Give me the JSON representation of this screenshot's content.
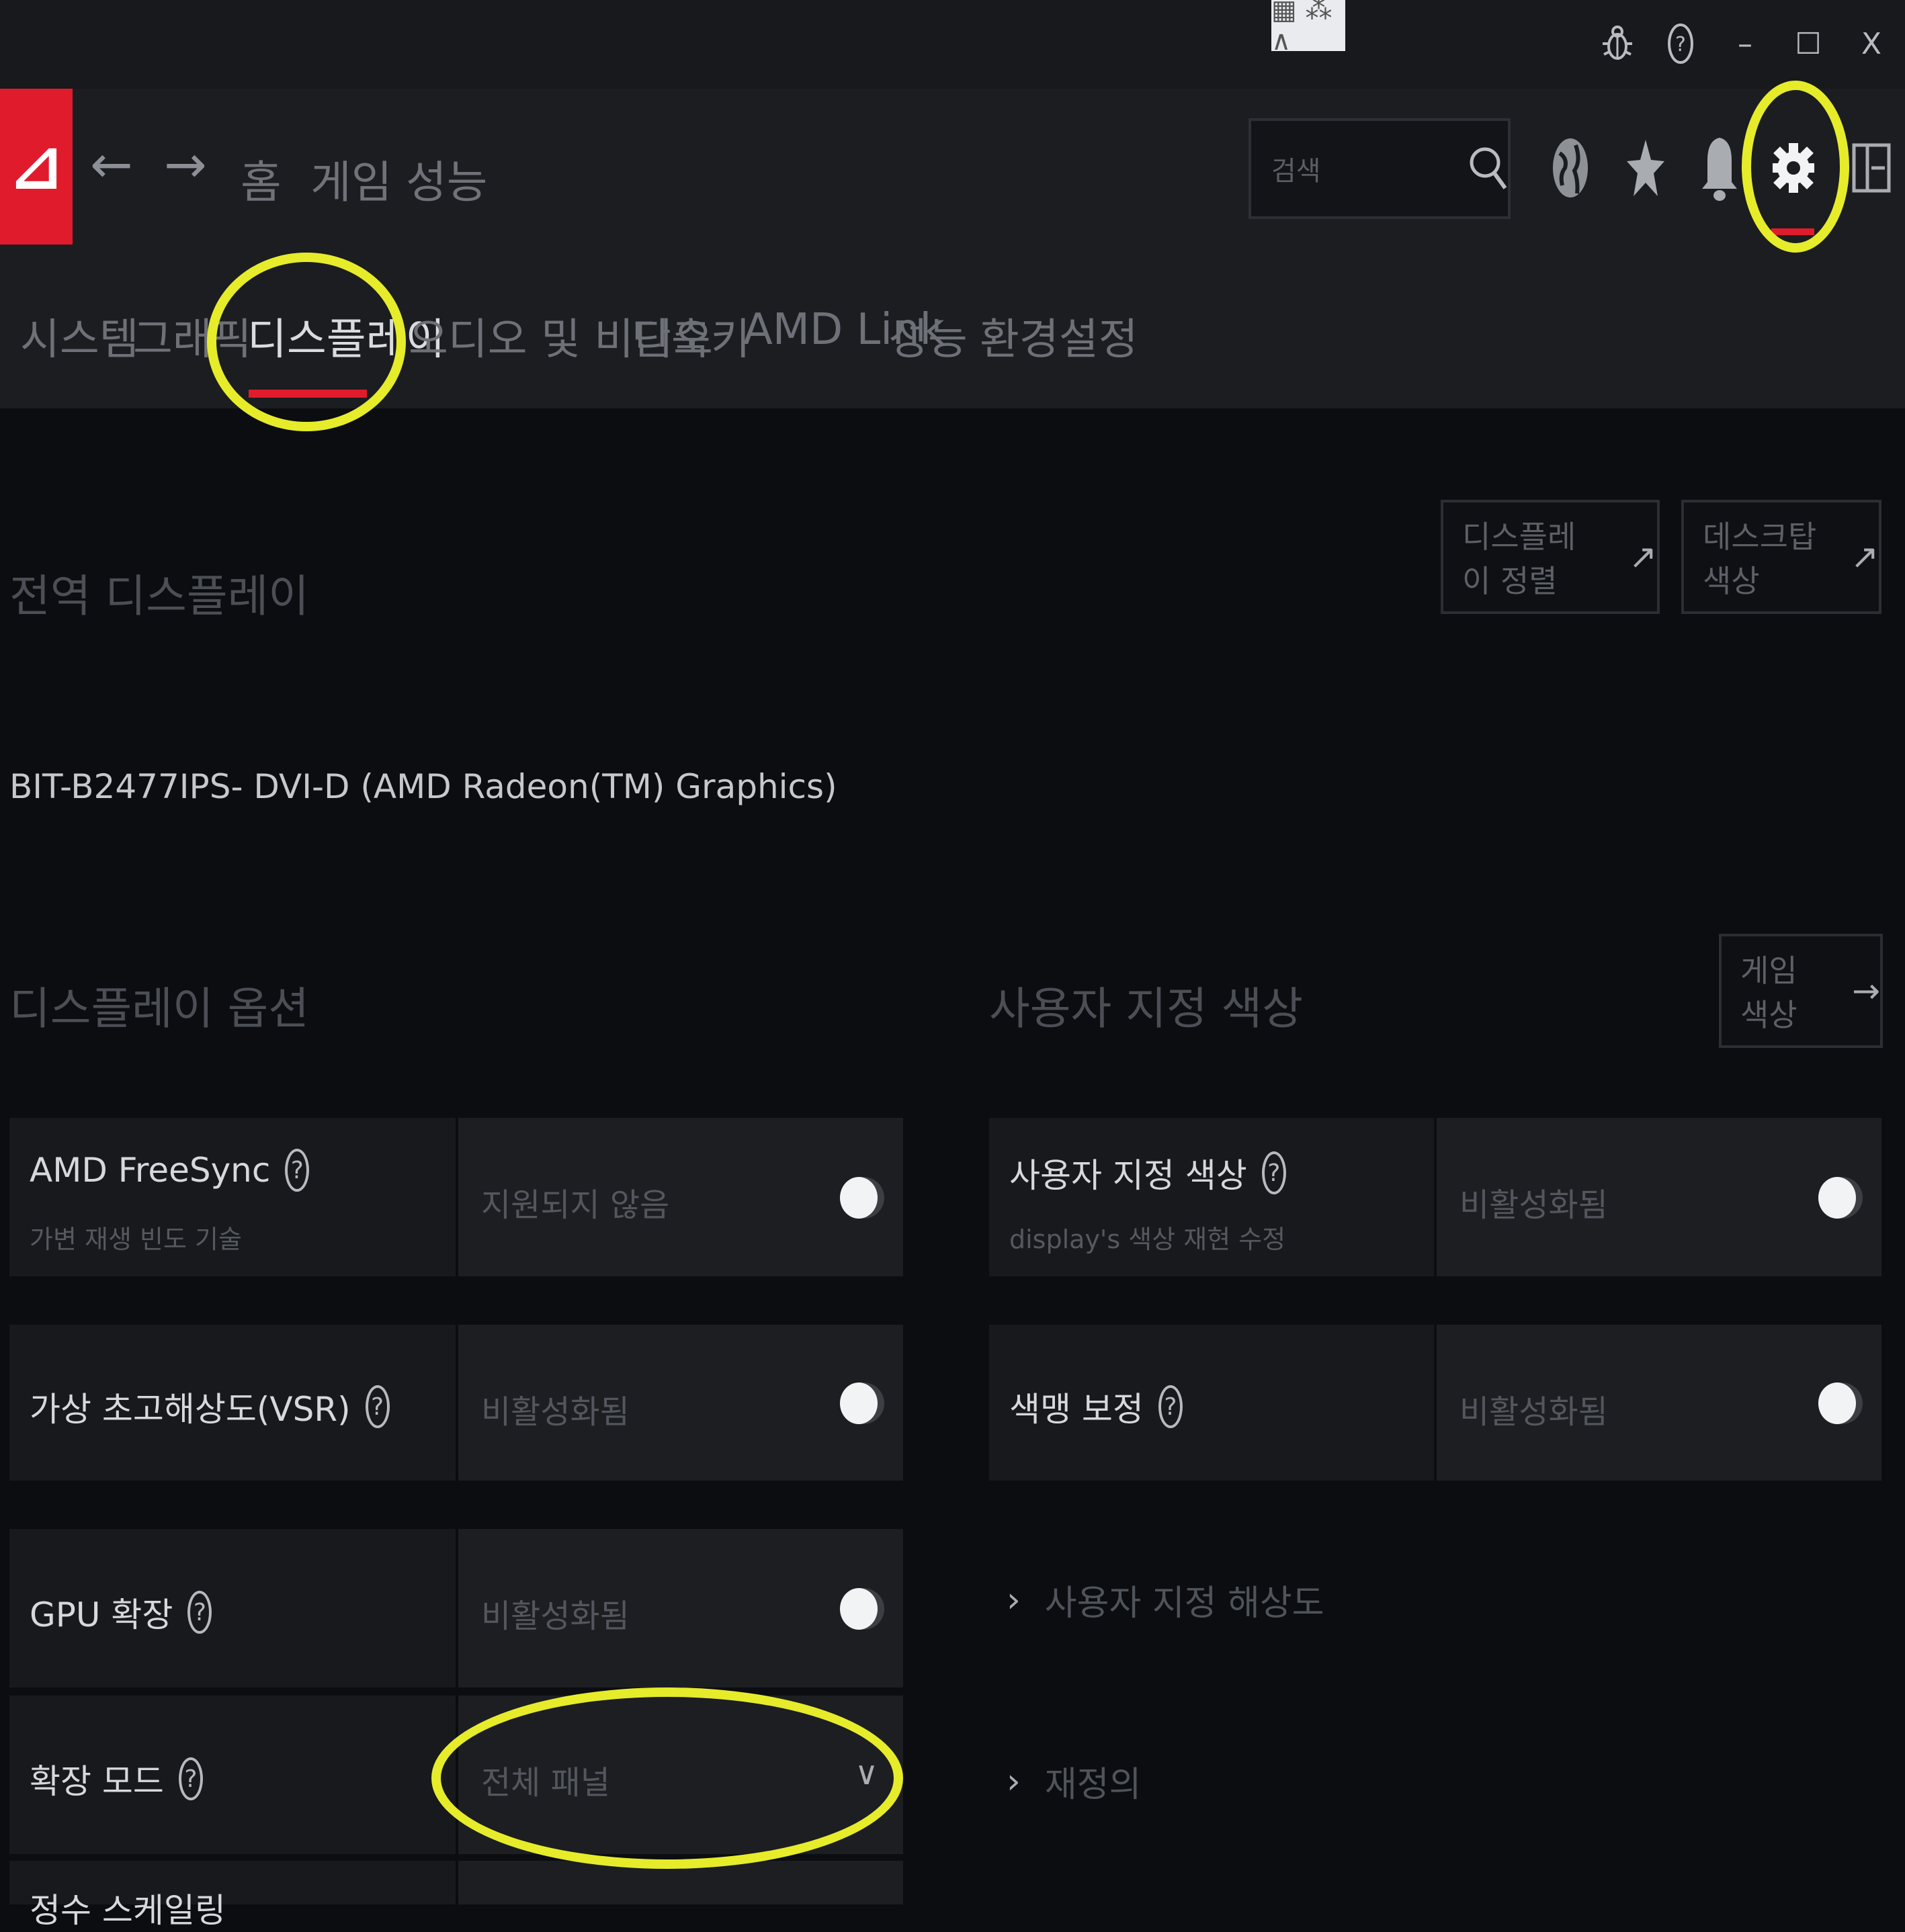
{
  "titlebar": {
    "tray_label": "▦ ⁂ ∧",
    "bug_icon": "bug-icon",
    "help_icon": "question-icon",
    "minimize_label": "–",
    "maximize_label": "☐",
    "close_label": "X"
  },
  "nav": {
    "logo_label": "⊿",
    "back_label": "←",
    "forward_label": "→",
    "links": [
      "홈",
      "게임",
      "성능"
    ],
    "search_placeholder": "검색"
  },
  "tabs": [
    {
      "label": "시스템"
    },
    {
      "label": "그래픽"
    },
    {
      "label": "디스플레이",
      "active": true
    },
    {
      "label": "오디오 및 비디오"
    },
    {
      "label": "단축키"
    },
    {
      "label": "AMD Link"
    },
    {
      "label": "성능"
    },
    {
      "label": "환경설정"
    }
  ],
  "global_display": {
    "title": "전역 디스플레이",
    "buttons": [
      "디스플레이 정렬",
      "데스크탑 색상"
    ]
  },
  "monitor_name": "BIT-B2477IPS- DVI-D (AMD Radeon(TM) Graphics)",
  "display_options": {
    "title": "디스플레이 옵션",
    "items": [
      {
        "label": "AMD FreeSync",
        "sub": "가변 재생 빈도 기술",
        "value": "지원되지 않음",
        "control": "toggle",
        "on": false
      },
      {
        "label": "가상 초고해상도(VSR)",
        "sub": "",
        "value": "비활성화됨",
        "control": "toggle",
        "on": false
      },
      {
        "label": "GPU 확장",
        "sub": "",
        "value": "비활성화됨",
        "control": "toggle",
        "on": false
      },
      {
        "label": "확장 모드",
        "sub": "",
        "value": "전체 패널",
        "control": "dropdown"
      },
      {
        "label": "정수 스케일링",
        "sub": "",
        "value": "",
        "control": "toggle",
        "on": false
      }
    ]
  },
  "custom_color": {
    "title": "사용자 지정 색상",
    "game_color_button": "게임 색상",
    "items": [
      {
        "label": "사용자 지정 색상",
        "sub": "display's 색상 재현 수정",
        "value": "비활성화됨",
        "control": "toggle",
        "on": false
      },
      {
        "label": "색맹 보정",
        "sub": "",
        "value": "비활성화됨",
        "control": "toggle",
        "on": false
      }
    ],
    "expanders": [
      "사용자 지정 해상도",
      "재정의"
    ]
  },
  "colors": {
    "accent": "#e01b2c",
    "highlight": "#e6ec2a"
  }
}
